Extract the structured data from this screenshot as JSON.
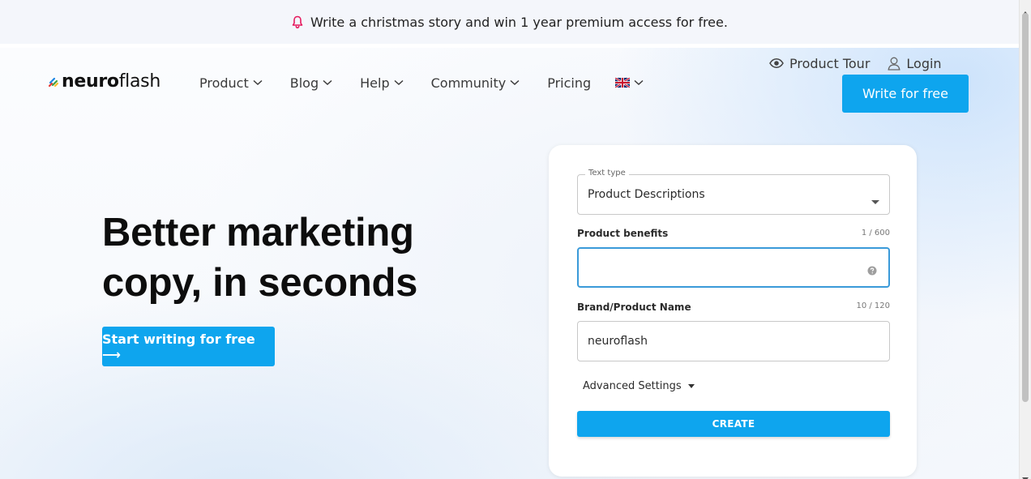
{
  "announcement": {
    "text": "Write a christmas story and win 1 year premium access for free.",
    "icon": "bell-icon",
    "icon_color": "#e5195e"
  },
  "brand": {
    "name_bold": "neuro",
    "name_light": "flash"
  },
  "nav": {
    "items": [
      {
        "label": "Product"
      },
      {
        "label": "Blog"
      },
      {
        "label": "Help"
      },
      {
        "label": "Community"
      },
      {
        "label": "Pricing"
      }
    ],
    "language_icon": "uk-flag-icon"
  },
  "header_links": {
    "product_tour": "Product Tour",
    "login": "Login",
    "write_for_free": "Write for free"
  },
  "hero": {
    "headline_line1": "Better marketing",
    "headline_line2": "copy, in seconds",
    "cta": "Start writing for free ⟶"
  },
  "form": {
    "text_type_label": "Text type",
    "text_type_value": "Product Descriptions",
    "benefits_label": "Product benefits",
    "benefits_counter": "1 / 600",
    "benefits_value": "",
    "brand_label": "Brand/Product Name",
    "brand_counter": "10 / 120",
    "brand_value": "neuroflash",
    "advanced_settings": "Advanced Settings",
    "create_button": "CREATE"
  },
  "colors": {
    "accent": "#0ea5ee",
    "focus_border": "#3a9ad9"
  }
}
